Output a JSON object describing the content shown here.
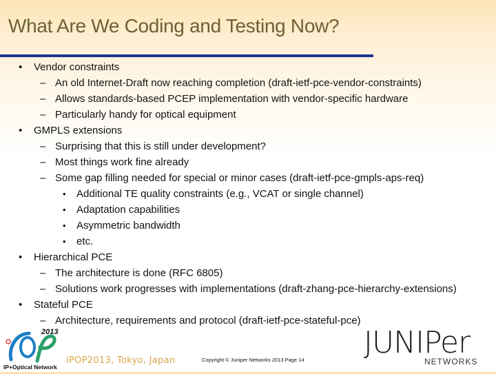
{
  "slide": {
    "title": "What Are We Coding and Testing Now?",
    "rule_color": "#1a3690",
    "title_color": "#6b6234"
  },
  "bullets": [
    {
      "level": 1,
      "marker": "•",
      "text": "Vendor constraints"
    },
    {
      "level": 2,
      "marker": "–",
      "text": "An old Internet-Draft now reaching completion (draft-ietf-pce-vendor-constraints)"
    },
    {
      "level": 2,
      "marker": "–",
      "text": "Allows standards-based PCEP implementation with vendor-specific hardware"
    },
    {
      "level": 2,
      "marker": "–",
      "text": "Particularly handy for optical equipment"
    },
    {
      "level": 1,
      "marker": "•",
      "text": "GMPLS extensions"
    },
    {
      "level": 2,
      "marker": "–",
      "text": "Surprising that this is still under development?"
    },
    {
      "level": 2,
      "marker": "–",
      "text": "Most things work fine already"
    },
    {
      "level": 2,
      "marker": "–",
      "text": "Some gap filling needed for special or minor cases (draft-ietf-pce-gmpls-aps-req)"
    },
    {
      "level": 3,
      "marker": "•",
      "text": "Additional TE quality constraints (e.g., VCAT or single channel)"
    },
    {
      "level": 3,
      "marker": "•",
      "text": "Adaptation capabilities"
    },
    {
      "level": 3,
      "marker": "•",
      "text": "Asymmetric bandwidth"
    },
    {
      "level": 3,
      "marker": "•",
      "text": "etc."
    },
    {
      "level": 1,
      "marker": "•",
      "text": "Hierarchical PCE"
    },
    {
      "level": 2,
      "marker": "–",
      "text": "The architecture is done (RFC 6805)"
    },
    {
      "level": 2,
      "marker": "–",
      "text": "Solutions work progresses with implementations (draft-zhang-pce-hierarchy-extensions)"
    },
    {
      "level": 1,
      "marker": "•",
      "text": "Stateful PCE"
    },
    {
      "level": 2,
      "marker": "–",
      "text": "Architecture, requirements and protocol (draft-ietf-pce-stateful-pce)"
    }
  ],
  "footer": {
    "logo_year": "2013",
    "logo_tagline": "IP+Optical Network",
    "event": "iPOP2013, Tokyo, Japan",
    "copyright": "Copyright © Juniper Networks 2013 Page 14",
    "brand_word": "JUNIPer",
    "brand_sub": "NETWORKS"
  }
}
